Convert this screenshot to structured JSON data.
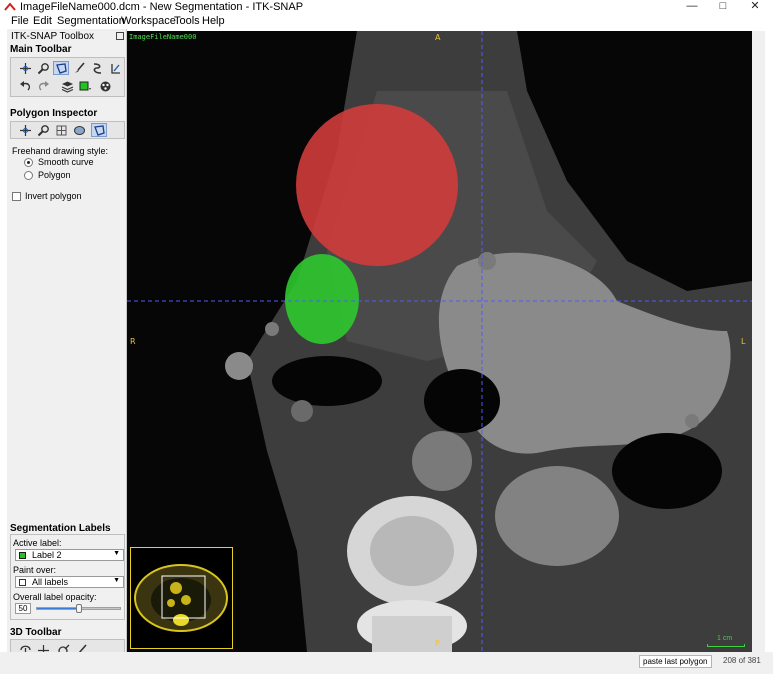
{
  "window": {
    "title": "ImageFileName000.dcm - New Segmentation - ITK-SNAP",
    "minimize_label": "—",
    "maximize_label": "□",
    "close_label": "✕"
  },
  "menu": {
    "items": [
      "File",
      "Edit",
      "Segmentation",
      "Workspace",
      "Tools",
      "Help"
    ]
  },
  "toolbox": {
    "title": "ITK-SNAP Toolbox",
    "main_toolbar_title": "Main Toolbar",
    "main_tools_row1": [
      "crosshair-tool",
      "zoom-tool",
      "polygon-tool",
      "paintbrush-tool",
      "snake-tool",
      "annotation-tool"
    ],
    "main_tools_row2": [
      "undo",
      "redo",
      "layers",
      "label-color",
      "3d-sphere"
    ],
    "polygon_inspector_title": "Polygon Inspector",
    "freehand_style_label": "Freehand drawing style:",
    "smooth_curve_label": "Smooth curve",
    "polygon_label": "Polygon",
    "smooth_curve_selected": true,
    "invert_polygon_label": "Invert polygon",
    "invert_polygon_checked": false,
    "segmentation_labels_title": "Segmentation Labels",
    "active_label_caption": "Active label:",
    "active_label_value": "Label 2",
    "active_label_color": "#22c422",
    "paint_over_caption": "Paint over:",
    "paint_over_value": "All labels",
    "opacity_caption": "Overall label opacity:",
    "opacity_value": "50",
    "opacity_fraction": 0.5,
    "toolbar_3d_title": "3D Toolbar"
  },
  "viewer": {
    "filename_overlay": "ImageFileName000",
    "orient_top": "A",
    "orient_bottom": "P",
    "orient_left": "R",
    "orient_right": "L",
    "scale_label": "1 cm",
    "segmentation_colors": {
      "label1": "#d23c3c",
      "label2": "#2ec82e"
    }
  },
  "status": {
    "paste_button": "paste last polygon",
    "slice_counter": "208 of 381"
  },
  "colors": {
    "crosshair": "#4a5cff",
    "orientation_text": "#f0c040",
    "thumbnail_border": "#e8d020"
  }
}
